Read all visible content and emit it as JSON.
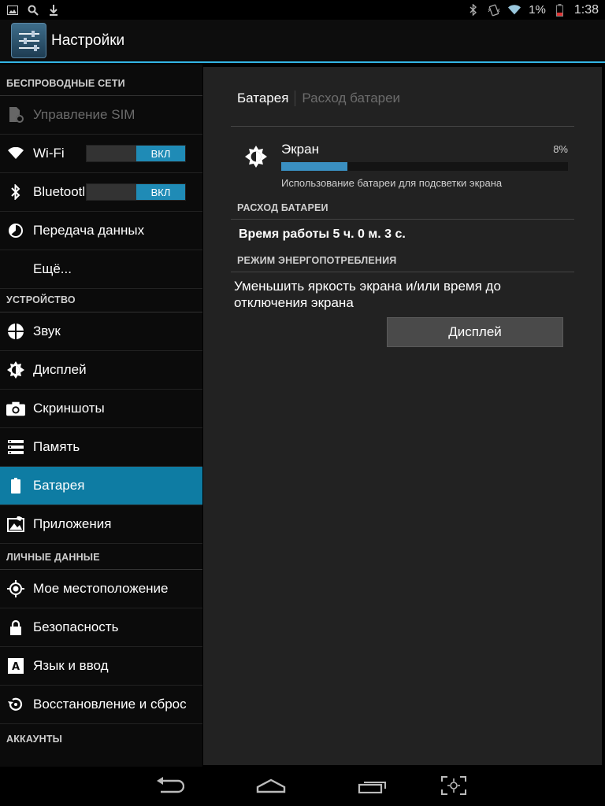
{
  "status_bar": {
    "battery_percent": "1%",
    "time": "1:38",
    "left_icons": [
      "gallery-icon",
      "search-icon",
      "download-icon"
    ],
    "right_icons": [
      "bluetooth-icon",
      "vibrate-icon",
      "wifi-icon",
      "battery-icon"
    ]
  },
  "action_bar": {
    "title": "Настройки"
  },
  "sidebar": {
    "sections": [
      {
        "header": "БЕСПРОВОДНЫЕ СЕТИ",
        "items": [
          {
            "label": "Управление SIM",
            "icon": "sim-settings-icon",
            "disabled": true
          },
          {
            "label": "Wi-Fi",
            "icon": "wifi-icon",
            "toggle": "ВКЛ"
          },
          {
            "label": "Bluetooth",
            "icon": "bluetooth-icon",
            "toggle": "ВКЛ"
          },
          {
            "label": "Передача данных",
            "icon": "data-usage-icon"
          },
          {
            "label": "Ещё...",
            "icon": ""
          }
        ]
      },
      {
        "header": "УСТРОЙСТВО",
        "items": [
          {
            "label": "Звук",
            "icon": "sound-icon"
          },
          {
            "label": "Дисплей",
            "icon": "display-icon"
          },
          {
            "label": "Скриншоты",
            "icon": "camera-icon"
          },
          {
            "label": "Память",
            "icon": "storage-icon"
          },
          {
            "label": "Батарея",
            "icon": "battery-icon",
            "selected": true
          },
          {
            "label": "Приложения",
            "icon": "apps-icon"
          }
        ]
      },
      {
        "header": "ЛИЧНЫЕ ДАННЫЕ",
        "items": [
          {
            "label": "Мое местоположение",
            "icon": "location-icon"
          },
          {
            "label": "Безопасность",
            "icon": "lock-icon"
          },
          {
            "label": "Язык и ввод",
            "icon": "language-icon"
          },
          {
            "label": "Восстановление и сброс",
            "icon": "restore-icon"
          }
        ]
      },
      {
        "header": "АККАУНТЫ",
        "items": []
      }
    ]
  },
  "detail": {
    "breadcrumb_active": "Батарея",
    "breadcrumb_inactive": "Расход батареи",
    "screen": {
      "title": "Экран",
      "percent": "8%",
      "usage_fraction": 0.23,
      "subtitle": "Использование батареи для подсветки экрана"
    },
    "battery_usage_header": "РАСХОД БАТАРЕИ",
    "uptime": "Время работы 5 ч. 0 м. 3 с.",
    "power_mode_header": "РЕЖИМ ЭНЕРГОПОТРЕБЛЕНИЯ",
    "power_text": "Уменьшить яркость экрана и/или время до отключения экрана",
    "display_button": "Дисплей"
  },
  "nav_bar": {
    "buttons": [
      "back-icon",
      "home-icon",
      "recents-icon",
      "screenshot-icon"
    ]
  },
  "colors": {
    "accent": "#33b5e5",
    "selected_item": "#0e7ca3",
    "toggle_on": "#1f8bb6",
    "progress": "#3a8fc1"
  }
}
